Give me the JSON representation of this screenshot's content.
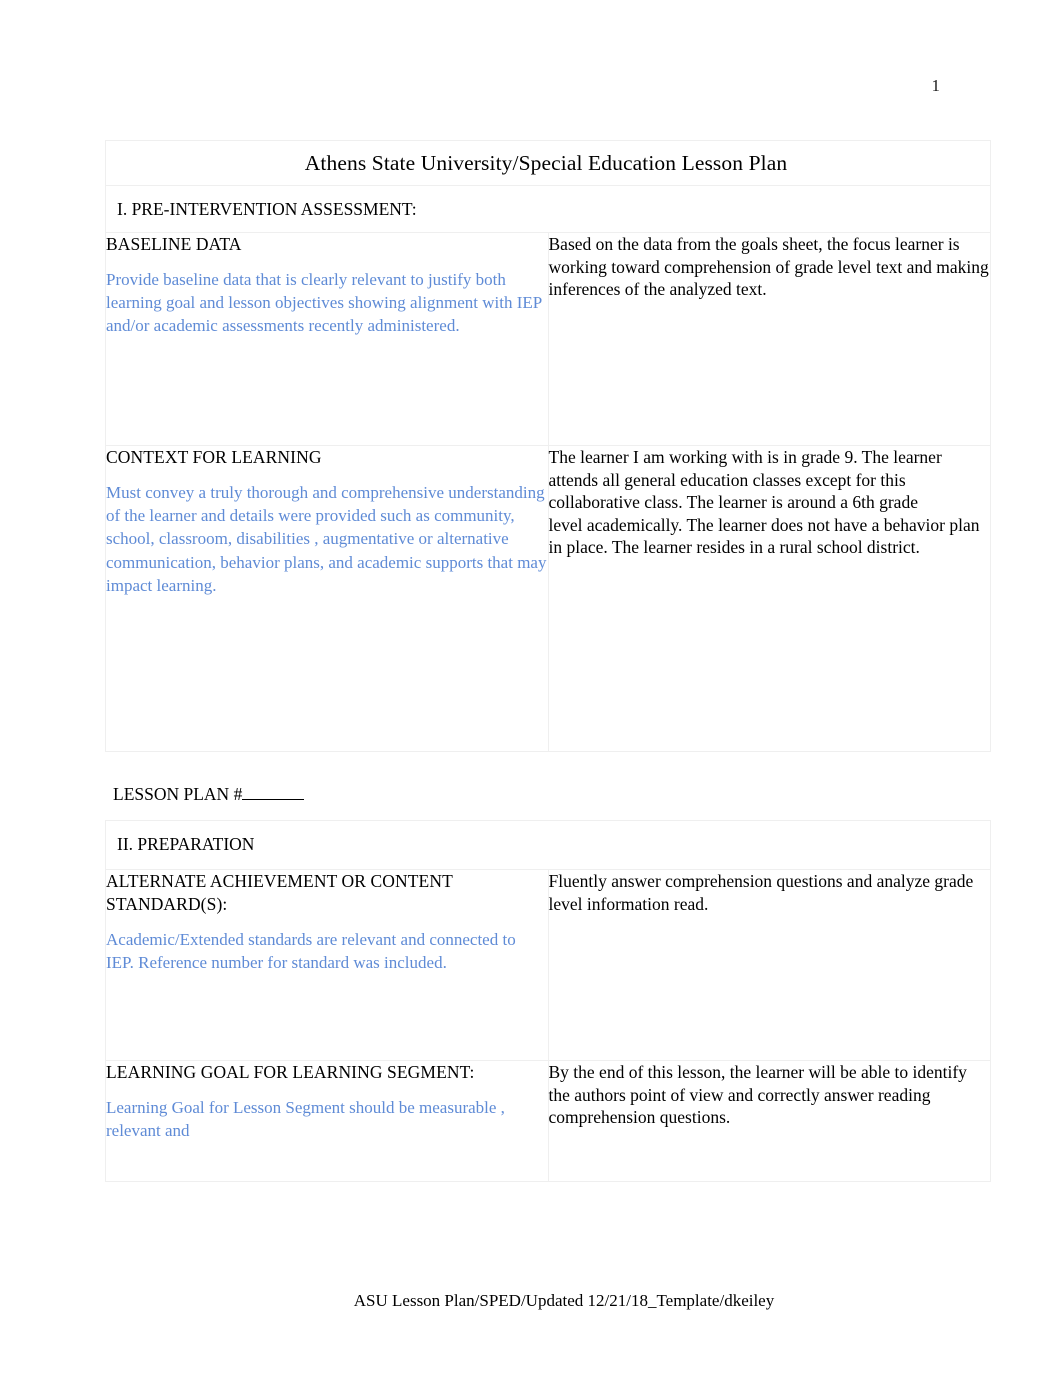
{
  "page": {
    "number": "1",
    "footer_text": "ASU Lesson Plan/SPED/Updated 12/21/18_Template/dkeiley"
  },
  "document": {
    "title": "Athens State University/Special Education Lesson Plan",
    "lesson_plan_label": "LESSON PLAN #",
    "colors": {
      "title_band": "#c3d3ed",
      "section_band": "#d6d6d6",
      "hint_text": "#5f8bd6",
      "body_text": "#000000"
    }
  },
  "sections": [
    {
      "heading": "I.  PRE-INTERVENTION ASSESSMENT:",
      "rows": [
        {
          "label": "BASELINE DATA",
          "hint": "Provide baseline data that is  clearly relevant  to justify both learning goal and lesson objectives showing alignment with IEP and/or academic assessments recently administered.",
          "value": "Based on the data from the goals sheet, the focus learner is working toward comprehension of grade level text and making inferences of the analyzed text."
        },
        {
          "label": "CONTEXT FOR LEARNING",
          "hint": "Must convey a truly thorough and comprehensive understanding of the learner and details were provided such as community, school, classroom, disabilities , augmentative or alternative communication, behavior plans, and academic supports that may impact learning.",
          "value": "The learner I am working with is in grade 9. The learner\nattends all general education classes except for this collaborative class. The learner is around a 6th grade\nlevel academically. The learner does not have a behavior plan in place. The learner resides in a rural school district."
        }
      ]
    },
    {
      "heading": "II. PREPARATION",
      "rows": [
        {
          "label": "ALTERNATE ACHIEVEMENT OR CONTENT STANDARD(S):",
          "hint": "Academic/Extended standards are relevant and connected to IEP. Reference number   for standard was included.",
          "value": "Fluently answer comprehension questions and analyze grade level information read."
        },
        {
          "label": "LEARNING GOAL FOR LEARNING SEGMENT:",
          "hint": "Learning Goal for Lesson Segment should be  measurable , relevant  and",
          "value": "By the end of this lesson, the learner will be able to identify the authors point of view and correctly answer reading comprehension questions."
        }
      ]
    }
  ]
}
